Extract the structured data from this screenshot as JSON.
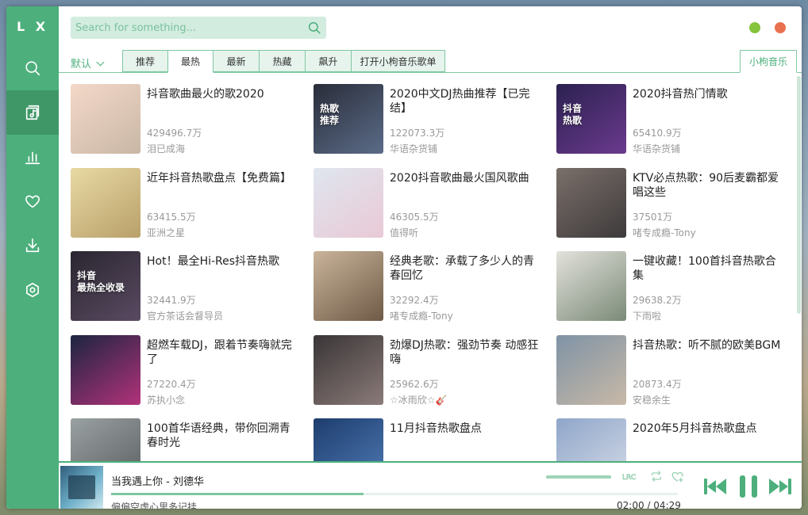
{
  "app": {
    "logo": "L X",
    "search_placeholder": "Search for something...",
    "colors": {
      "accent": "#4daf7c",
      "minimize": "#85c43b",
      "close": "#e9714f"
    }
  },
  "sidebar": {
    "items": [
      {
        "name": "search",
        "icon": "search-icon"
      },
      {
        "name": "songlist",
        "icon": "music-list-icon",
        "active": true
      },
      {
        "name": "leaderboard",
        "icon": "bar-chart-icon"
      },
      {
        "name": "favorites",
        "icon": "heart-icon"
      },
      {
        "name": "download",
        "icon": "download-icon"
      },
      {
        "name": "settings",
        "icon": "settings-icon"
      }
    ]
  },
  "tabs": {
    "sort_label": "默认",
    "items": [
      "推荐",
      "最热",
      "最新",
      "热藏",
      "飙升",
      "打开小枸音乐歌单"
    ],
    "active": "最热",
    "source_label": "小枸音乐"
  },
  "playlists": [
    {
      "title": "抖音歌曲最火的歌2020",
      "plays": "429496.7万",
      "author": "泪已成海",
      "cover": [
        "#f4d8c8",
        "#c9b7a6"
      ]
    },
    {
      "title": "2020中文DJ热曲推荐【已完结】",
      "plays": "122073.3万",
      "author": "华语杂货铺",
      "cover": [
        "#2a2d3a",
        "#5b6c88"
      ],
      "cover_text": "热歌\n推荐"
    },
    {
      "title": "2020抖音热门情歌",
      "plays": "65410.9万",
      "author": "华语杂货铺",
      "cover": [
        "#2b2150",
        "#6b3a8e"
      ],
      "cover_text": "抖音\n热歌"
    },
    {
      "title": "近年抖音热歌盘点【免费篇】",
      "plays": "63415.5万",
      "author": "亚洲之星",
      "cover": [
        "#e8d9a3",
        "#b9a06a"
      ]
    },
    {
      "title": "2020抖音歌曲最火国风歌曲",
      "plays": "46305.5万",
      "author": "值得听",
      "cover": [
        "#dfe6ef",
        "#e9c9d6"
      ]
    },
    {
      "title": "KTV必点热歌：90后麦霸都爱唱这些",
      "plays": "37501万",
      "author": "啫专成瘾-Tony",
      "cover": [
        "#7a6f6a",
        "#3e3a3b"
      ]
    },
    {
      "title": "Hot！最全Hi-Res抖音热歌",
      "plays": "32441.9万",
      "author": "官方茶话会督导员",
      "cover": [
        "#2a2630",
        "#5a4a62"
      ],
      "cover_text": "抖音\n最热全收录"
    },
    {
      "title": "经典老歌：承载了多少人的青春回忆",
      "plays": "32292.4万",
      "author": "啫专成瘾-Tony",
      "cover": [
        "#c9b49a",
        "#6f5a47"
      ]
    },
    {
      "title": "一键收藏！100首抖音热歌合集",
      "plays": "29638.2万",
      "author": "下雨啦",
      "cover": [
        "#e3e2dc",
        "#7b8a78"
      ]
    },
    {
      "title": "超燃车载DJ，跟着节奏嗨就完了",
      "plays": "27220.4万",
      "author": "苏执小念",
      "cover": [
        "#1c2540",
        "#b2327a"
      ]
    },
    {
      "title": "劲爆DJ热歌：强劲节奏 动感狂嗨",
      "plays": "25962.6万",
      "author": "☆冰雨欣☆🎸",
      "cover": [
        "#3a3537",
        "#8a7b78"
      ]
    },
    {
      "title": "抖音热歌：听不腻的欧美BGM",
      "plays": "20873.4万",
      "author": "安稳余生",
      "cover": [
        "#7f93a6",
        "#c8b9a7"
      ]
    },
    {
      "title": "100首华语经典，带你回溯青春时光",
      "plays": "",
      "author": "",
      "cover": [
        "#9aa1a3",
        "#5a5e60"
      ]
    },
    {
      "title": "11月抖音热歌盘点",
      "plays": "",
      "author": "",
      "cover": [
        "#1e3d6e",
        "#4f7bb5"
      ]
    },
    {
      "title": "2020年5月抖音热歌盘点",
      "plays": "",
      "author": "",
      "cover": [
        "#8fa6c9",
        "#d5dbe8"
      ]
    }
  ],
  "player": {
    "title": "当我遇上你 - 刘德华",
    "lyric": "偏偏空虚心里多记挂",
    "current_time": "02:00",
    "separator": "/",
    "total_time": "04:29",
    "progress": 0.446,
    "volume": 1.0,
    "lrc_label": "LRC"
  }
}
